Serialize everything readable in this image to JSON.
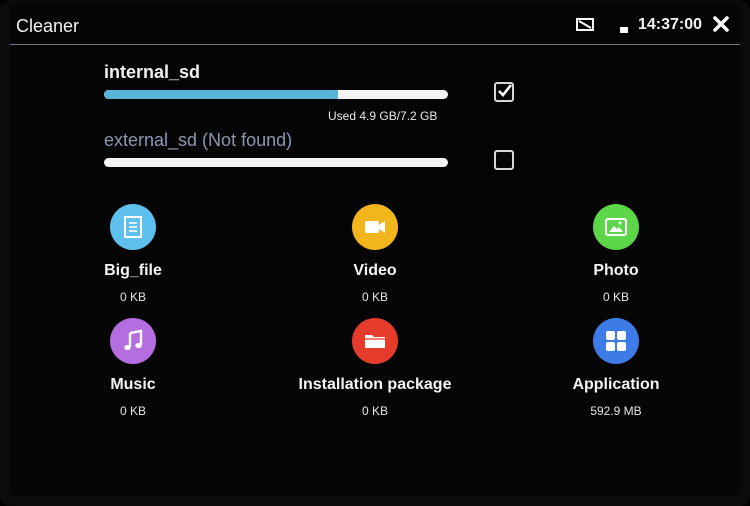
{
  "header": {
    "title": "Cleaner",
    "time": "14:37:00",
    "icons": {
      "cast": "cast-icon",
      "battery": "battery-icon",
      "close": "close-icon"
    }
  },
  "storage": [
    {
      "name": "internal_sd",
      "usage": "Used 4.9 GB/7.2 GB",
      "used_fraction": 0.68,
      "checked": true,
      "color": "#5ab3d8"
    },
    {
      "name": "external_sd (Not found)",
      "usage": "",
      "used_fraction": 0,
      "checked": false
    }
  ],
  "categories": [
    {
      "label": "Big_file",
      "size": "0 KB",
      "icon": "document-icon",
      "color": "#5ec0ec"
    },
    {
      "label": "Video",
      "size": "0 KB",
      "icon": "video-camera-icon",
      "color": "#f2b51c"
    },
    {
      "label": "Photo",
      "size": "0 KB",
      "icon": "image-icon",
      "color": "#5ed64a"
    },
    {
      "label": "Music",
      "size": "0 KB",
      "icon": "music-note-icon",
      "color": "#b56ee0"
    },
    {
      "label": "Installation package",
      "size": "0 KB",
      "icon": "folder-icon",
      "color": "#e63a2a"
    },
    {
      "label": "Application",
      "size": "592.9 MB",
      "icon": "grid-apps-icon",
      "color": "#3d7ce6"
    }
  ]
}
